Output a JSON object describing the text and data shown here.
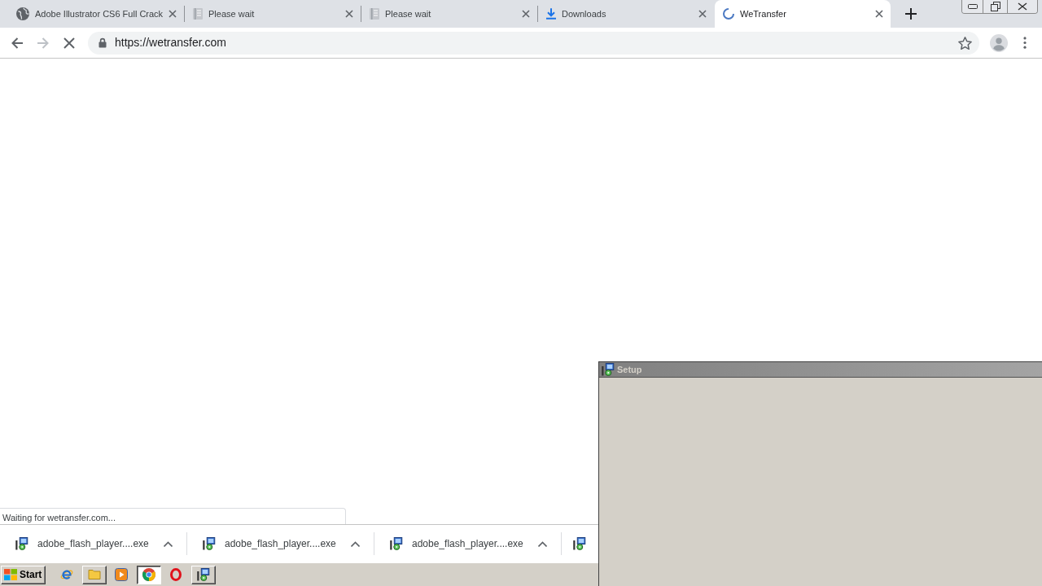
{
  "tabs": [
    {
      "title": "Adobe Illustrator CS6 Full Crack",
      "selected": false,
      "loading": false
    },
    {
      "title": "Please wait",
      "selected": false,
      "loading": false
    },
    {
      "title": "Please wait",
      "selected": false,
      "loading": false
    },
    {
      "title": "Downloads",
      "selected": false,
      "loading": false
    },
    {
      "title": "WeTransfer",
      "selected": true,
      "loading": true
    }
  ],
  "toolbar": {
    "nav_buttons": [
      {
        "kind": "back",
        "disabled": false
      },
      {
        "kind": "forward",
        "disabled": true
      }
    ],
    "url": "https://wetransfer.com"
  },
  "status_bubble": "Waiting for wetransfer.com...",
  "download_shelf": {
    "items": [
      {
        "kind": "full",
        "filename": "adobe_flash_player....exe"
      },
      {
        "kind": "full",
        "filename": "adobe_flash_player....exe"
      },
      {
        "kind": "full",
        "filename": "adobe_flash_player....exe"
      },
      {
        "kind": "clipped"
      }
    ]
  },
  "setup_window": {
    "title": "Setup"
  },
  "taskbar": {
    "start_label": "Start",
    "buttons": [
      {
        "kind": "launcher",
        "selected": false
      },
      {
        "kind": "task",
        "selected": false
      },
      {
        "kind": "launcher",
        "selected": false
      },
      {
        "kind": "task",
        "selected": true
      },
      {
        "kind": "launcher",
        "selected": false
      },
      {
        "kind": "task",
        "selected": false
      }
    ]
  }
}
